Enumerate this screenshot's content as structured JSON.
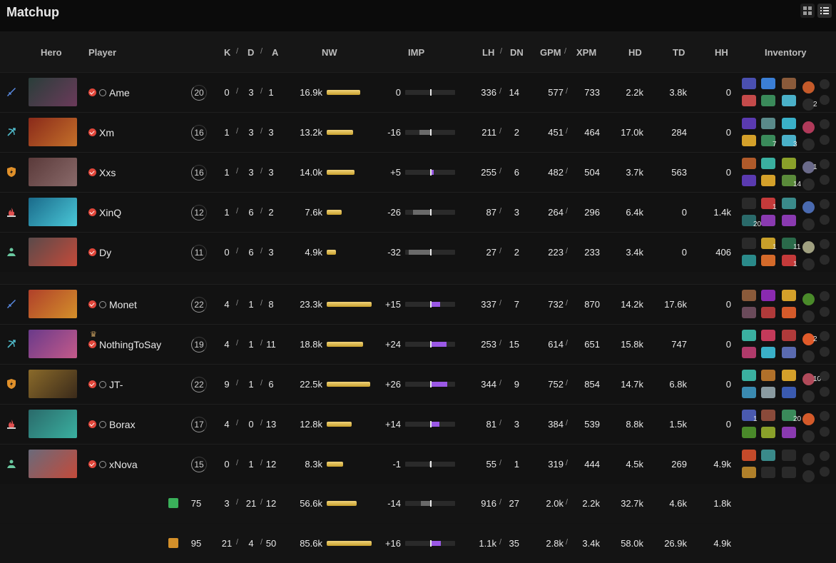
{
  "title": "Matchup",
  "view_toggle": {
    "grid_icon": "grid-icon",
    "list_icon": "list-icon"
  },
  "columns": {
    "hero": "Hero",
    "player": "Player",
    "k": "K",
    "d": "D",
    "a": "A",
    "nw": "NW",
    "imp": "IMP",
    "lh": "LH",
    "dn": "DN",
    "gpm": "GPM",
    "xpm": "XPM",
    "hd": "HD",
    "td": "TD",
    "hh": "HH",
    "inventory": "Inventory"
  },
  "colors": {
    "nw_bar": "#d9b44a",
    "imp_positive": "#9b59e6",
    "imp_negative": "#6a6a6a",
    "check": "#e0463a"
  },
  "teams": [
    {
      "players": [
        {
          "role_icon": "sword-icon",
          "role_color": "#5b8de8",
          "hero_colors": [
            "#2a3e3a",
            "#6b3a5a"
          ],
          "name": "Ame",
          "rank_icon": true,
          "level": "20",
          "k": "0",
          "d": "3",
          "a": "1",
          "nw": "16.9k",
          "nw_frac": 0.74,
          "imp": "0",
          "imp_val": 0,
          "lh": "336",
          "dn": "14",
          "gpm": "577",
          "xpm": "733",
          "hd": "2.2k",
          "td": "3.8k",
          "hh": "0",
          "items": [
            "#4a4fb0",
            "#3b7fd6",
            "#8a5a3a",
            "#c45a2a",
            "#c44a4a",
            "#3a8a5a",
            "#4ab0c8",
            "#2a2a2a"
          ],
          "item_nums": {
            "7": "2"
          }
        },
        {
          "role_icon": "bow-icon",
          "role_color": "#4fb8c8",
          "hero_colors": [
            "#8a2a1a",
            "#c4702a"
          ],
          "name": "Xm",
          "rank_icon": false,
          "level": "16",
          "k": "1",
          "d": "3",
          "a": "3",
          "nw": "13.2k",
          "nw_frac": 0.58,
          "imp": "-16",
          "imp_val": -16,
          "lh": "211",
          "dn": "2",
          "gpm": "451",
          "xpm": "464",
          "hd": "17.0k",
          "td": "284",
          "hh": "0",
          "items": [
            "#5a3ab0",
            "#5a8a8a",
            "#3ab0c8",
            "#b03a5a",
            "#d4a02a",
            "#3a8a5a",
            "#4ab0c8",
            "#2a2a2a"
          ],
          "item_nums": {
            "5": "7",
            "6": "3"
          }
        },
        {
          "role_icon": "shield-icon",
          "role_color": "#e0902a",
          "hero_colors": [
            "#5a3a3a",
            "#8a6a6a"
          ],
          "name": "Xxs",
          "rank_icon": false,
          "level": "16",
          "k": "1",
          "d": "3",
          "a": "3",
          "nw": "14.0k",
          "nw_frac": 0.62,
          "imp": "+5",
          "imp_val": 5,
          "lh": "255",
          "dn": "6",
          "gpm": "482",
          "xpm": "504",
          "hd": "3.7k",
          "td": "563",
          "hh": "0",
          "items": [
            "#b05a2a",
            "#3ab0a0",
            "#8aa02a",
            "#6a6a8a",
            "#5a3ab0",
            "#d4a02a",
            "#5a8a3a",
            "#2a2a2a"
          ],
          "item_nums": {
            "3": "1",
            "6": "14"
          }
        },
        {
          "role_icon": "fire-icon",
          "role_color": "#e05050",
          "hero_colors": [
            "#1a6a8a",
            "#4ac8d8"
          ],
          "name": "XinQ",
          "rank_icon": false,
          "level": "12",
          "k": "1",
          "d": "6",
          "a": "2",
          "nw": "7.6k",
          "nw_frac": 0.33,
          "imp": "-26",
          "imp_val": -26,
          "lh": "87",
          "dn": "3",
          "gpm": "264",
          "xpm": "296",
          "hd": "6.4k",
          "td": "0",
          "hh": "1.4k",
          "items": [
            "#2a2a2a",
            "#c43a3a",
            "#3a8a8a",
            "#4a6ab0",
            "#2a6a6a",
            "#8a3ab0",
            "#8a3ab0",
            "#2a2a2a"
          ],
          "item_nums": {
            "1": "1",
            "4": "20"
          }
        },
        {
          "role_icon": "support-icon",
          "role_color": "#6ac8a0",
          "hero_colors": [
            "#5a4a4a",
            "#c44a3a"
          ],
          "name": "Dy",
          "rank_icon": false,
          "level": "11",
          "k": "0",
          "d": "6",
          "a": "3",
          "nw": "4.9k",
          "nw_frac": 0.2,
          "imp": "-32",
          "imp_val": -32,
          "lh": "27",
          "dn": "2",
          "gpm": "223",
          "xpm": "233",
          "hd": "3.4k",
          "td": "0",
          "hh": "406",
          "items": [
            "#2a2a2a",
            "#c8a02a",
            "#2a6a4a",
            "#a0a080",
            "#2a8a8a",
            "#d46a2a",
            "#c43a3a",
            "#2a2a2a"
          ],
          "item_nums": {
            "1": "1",
            "2": "11",
            "6": "1"
          }
        }
      ]
    },
    {
      "players": [
        {
          "role_icon": "sword-icon",
          "role_color": "#5b8de8",
          "hero_colors": [
            "#b0402a",
            "#d4902a"
          ],
          "name": "Monet",
          "rank_icon": true,
          "level": "22",
          "k": "4",
          "d": "1",
          "a": "8",
          "nw": "23.3k",
          "nw_frac": 1.0,
          "imp": "+15",
          "imp_val": 15,
          "lh": "337",
          "dn": "7",
          "gpm": "732",
          "xpm": "870",
          "hd": "14.2k",
          "td": "17.6k",
          "hh": "0",
          "items": [
            "#8a5a3a",
            "#8a2ab0",
            "#d4a02a",
            "#4a8a2a",
            "#6a4a5a",
            "#b03a3a",
            "#d45a2a",
            "#2a2a2a"
          ],
          "item_nums": {}
        },
        {
          "role_icon": "bow-icon",
          "role_color": "#4fb8c8",
          "hero_colors": [
            "#6a3a8a",
            "#c45a8a"
          ],
          "name": "NothingToSay",
          "rank_icon": false,
          "crown": true,
          "level": "19",
          "k": "4",
          "d": "1",
          "a": "11",
          "nw": "18.8k",
          "nw_frac": 0.81,
          "imp": "+24",
          "imp_val": 24,
          "lh": "253",
          "dn": "15",
          "gpm": "614",
          "xpm": "651",
          "hd": "15.8k",
          "td": "747",
          "hh": "0",
          "items": [
            "#3ab0a0",
            "#c43a5a",
            "#b03a3a",
            "#e05a2a",
            "#b03a6a",
            "#3ab0c8",
            "#5a6ab0",
            "#2a2a2a"
          ],
          "item_nums": {
            "3": "2"
          }
        },
        {
          "role_icon": "shield-icon",
          "role_color": "#e0902a",
          "hero_colors": [
            "#8a6a2a",
            "#3a2a1a"
          ],
          "name": "JT-",
          "rank_icon": true,
          "level": "22",
          "k": "9",
          "d": "1",
          "a": "6",
          "nw": "22.5k",
          "nw_frac": 0.97,
          "imp": "+26",
          "imp_val": 26,
          "lh": "344",
          "dn": "9",
          "gpm": "752",
          "xpm": "854",
          "hd": "14.7k",
          "td": "6.8k",
          "hh": "0",
          "items": [
            "#3ab0a0",
            "#b0702a",
            "#d4a02a",
            "#b04a5a",
            "#3a8ab0",
            "#8a9aa0",
            "#3a5ab0",
            "#2a2a2a"
          ],
          "item_nums": {
            "3": "10"
          }
        },
        {
          "role_icon": "fire-icon",
          "role_color": "#e05050",
          "hero_colors": [
            "#2a6a6a",
            "#3ab0a0"
          ],
          "name": "Borax",
          "rank_icon": true,
          "level": "17",
          "k": "4",
          "d": "0",
          "a": "13",
          "nw": "12.8k",
          "nw_frac": 0.56,
          "imp": "+14",
          "imp_val": 14,
          "lh": "81",
          "dn": "3",
          "gpm": "384",
          "xpm": "539",
          "hd": "8.8k",
          "td": "1.5k",
          "hh": "0",
          "items": [
            "#4a5ab0",
            "#8a4a3a",
            "#3a8a5a",
            "#d45a2a",
            "#4a8a2a",
            "#8aa02a",
            "#8a3ab0",
            "#2a2a2a"
          ],
          "item_nums": {
            "0": "1",
            "2": "20"
          }
        },
        {
          "role_icon": "support-icon",
          "role_color": "#6ac8a0",
          "hero_colors": [
            "#6a6a7a",
            "#c44a3a"
          ],
          "name": "xNova",
          "rank_icon": true,
          "level": "15",
          "k": "0",
          "d": "1",
          "a": "12",
          "nw": "8.3k",
          "nw_frac": 0.36,
          "imp": "-1",
          "imp_val": -1,
          "lh": "55",
          "dn": "1",
          "gpm": "319",
          "xpm": "444",
          "hd": "4.5k",
          "td": "269",
          "hh": "4.9k",
          "items": [
            "#c44a2a",
            "#3a8a8a",
            "#2a2a2a",
            "#2a2a2a",
            "#b0802a",
            "#2a2a2a",
            "#2a2a2a",
            "#2a2a2a"
          ],
          "item_nums": {}
        }
      ]
    }
  ],
  "totals": [
    {
      "faction_icon": "radiant-icon",
      "faction_color": "#3ab05a",
      "level": "75",
      "k": "3",
      "d": "21",
      "a": "12",
      "nw": "56.6k",
      "nw_frac": 0.66,
      "imp": "-14",
      "imp_val": -14,
      "lh": "916",
      "dn": "27",
      "gpm": "2.0k",
      "xpm": "2.2k",
      "hd": "32.7k",
      "td": "4.6k",
      "hh": "1.8k"
    },
    {
      "faction_icon": "dire-icon",
      "faction_color": "#d4902a",
      "level": "95",
      "k": "21",
      "d": "4",
      "a": "50",
      "nw": "85.6k",
      "nw_frac": 1.0,
      "imp": "+16",
      "imp_val": 16,
      "lh": "1.1k",
      "dn": "35",
      "gpm": "2.8k",
      "xpm": "3.4k",
      "hd": "58.0k",
      "td": "26.9k",
      "hh": "4.9k"
    }
  ]
}
